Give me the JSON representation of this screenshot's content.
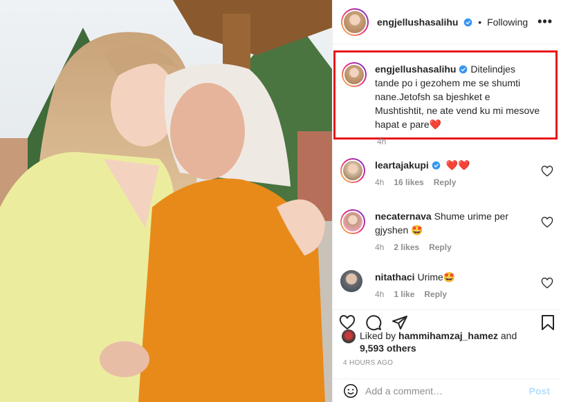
{
  "header": {
    "username": "engjellushasalihu",
    "separator": "•",
    "follow_state": "Following",
    "more": "•••"
  },
  "caption": {
    "username": "engjellushasalihu",
    "text": "Ditelindjes tande po i gezohem me se shumti nane.Jetofsh sa bjeshket e Mushtishtit, ne ate vend ku mi mesove hapat e pare",
    "emoji": "❤️",
    "time": "4h"
  },
  "comments": [
    {
      "username": "leartajakupi",
      "text": "",
      "emoji": "❤️❤️",
      "time": "4h",
      "likes": "16 likes",
      "reply": "Reply"
    },
    {
      "username": "necaternava",
      "text": "Shume urime per gjyshen",
      "emoji": "🤩",
      "time": "4h",
      "likes": "2 likes",
      "reply": "Reply"
    },
    {
      "username": "nitathaci",
      "text": "Urime",
      "emoji": "🤩",
      "time": "4h",
      "likes": "1 like",
      "reply": "Reply"
    }
  ],
  "likes": {
    "prefix": "Liked by",
    "user": "hammihamzaj_hamez",
    "suffix": "and",
    "others": "9,593 others"
  },
  "timestamp": "4 HOURS AGO",
  "add_comment": {
    "placeholder": "Add a comment…",
    "post_label": "Post"
  },
  "colors": {
    "highlight_border": "#e8141a",
    "verified": "#3897f0",
    "post_button": "#b2dffc"
  }
}
